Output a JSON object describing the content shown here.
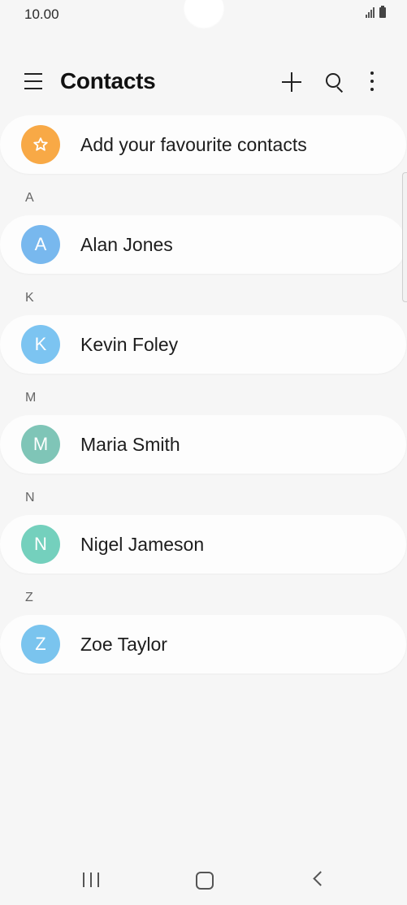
{
  "status_bar": {
    "time": "10.00"
  },
  "header": {
    "title": "Contacts",
    "icons": [
      "menu-icon",
      "add-icon",
      "search-icon",
      "more-icon"
    ]
  },
  "favourites": {
    "label": "Add your favourite contacts",
    "icon": "star-icon",
    "color": "#f8a946"
  },
  "sections": [
    {
      "letter": "A",
      "contact": {
        "initial": "A",
        "name": "Alan Jones",
        "color": "#78b8ee"
      }
    },
    {
      "letter": "K",
      "contact": {
        "initial": "K",
        "name": "Kevin Foley",
        "color": "#7cc4f1"
      }
    },
    {
      "letter": "M",
      "contact": {
        "initial": "M",
        "name": "Maria Smith",
        "color": "#7fc5b7"
      }
    },
    {
      "letter": "N",
      "contact": {
        "initial": "N",
        "name": "Nigel Jameson",
        "color": "#74d0bd"
      }
    },
    {
      "letter": "Z",
      "contact": {
        "initial": "Z",
        "name": "Zoe Taylor",
        "color": "#7ac4ee"
      }
    }
  ],
  "nav_bar": {
    "icons": [
      "recent-apps-icon",
      "home-icon",
      "back-icon"
    ]
  }
}
